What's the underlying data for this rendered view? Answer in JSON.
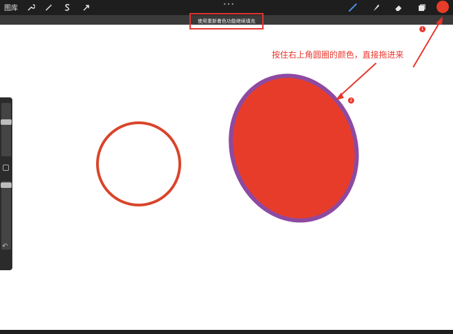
{
  "toolbar": {
    "gallery_label": "图库",
    "left_tools": [
      {
        "name": "actions",
        "icon": "wrench-icon"
      },
      {
        "name": "adjustments",
        "icon": "magic-wand-icon"
      },
      {
        "name": "selection",
        "icon": "s-select-icon"
      },
      {
        "name": "transform",
        "icon": "arrow-cursor-icon"
      }
    ],
    "right_tools": [
      {
        "name": "brush",
        "icon": "brush-icon"
      },
      {
        "name": "smudge",
        "icon": "smudge-icon"
      },
      {
        "name": "eraser",
        "icon": "eraser-icon"
      },
      {
        "name": "layers",
        "icon": "layers-icon"
      }
    ],
    "current_color": "#e73c2a"
  },
  "hint": {
    "text": "使用重新着色功能继续填充"
  },
  "annotation": {
    "text": "按住右上角圆圈的颜色，直接拖进来",
    "badge1": "1",
    "badge2": "2"
  },
  "colors": {
    "accent_red": "#e8352c",
    "fill_red": "#e73c2a",
    "ellipse_outline": "#8e4aa1",
    "circle_outline": "#d9452b"
  }
}
